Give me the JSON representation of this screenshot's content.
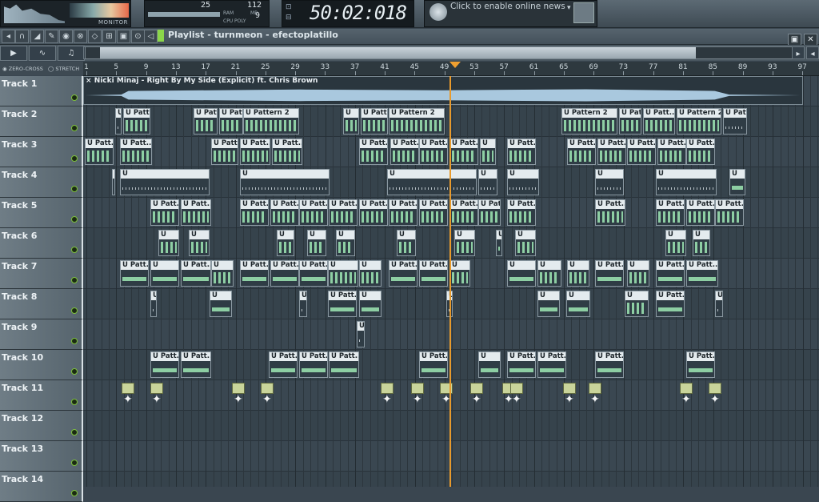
{
  "monitor": {
    "label": "MONITOR"
  },
  "cpu": {
    "value_a": "25",
    "value_b": "112",
    "value_c": "9",
    "label_ram": "RAM",
    "label_mb": "MB",
    "label_cpu": "CPU",
    "label_poly": "POLY"
  },
  "clock": {
    "time": "50:02:018",
    "icon_a": "REC",
    "icon_b": "SONG"
  },
  "news": {
    "text": "Click to enable online news"
  },
  "playlist": {
    "title": "Playlist - turnmeon - efectoplatillo"
  },
  "snap": {
    "zero_cross": "ZERO-CROSS",
    "stretch": "STRETCH"
  },
  "ruler": {
    "bars": [
      "1",
      "5",
      "9",
      "13",
      "17",
      "21",
      "25",
      "29",
      "33",
      "37",
      "41",
      "45",
      "49",
      "53",
      "57",
      "61",
      "65",
      "69",
      "73",
      "77",
      "81",
      "85",
      "89",
      "93",
      "97"
    ]
  },
  "audio_clip": {
    "name": "Nicki Minaj - Right By My Side (Explicit) ft. Chris Brown"
  },
  "tracks": [
    "Track 1",
    "Track 2",
    "Track 3",
    "Track 4",
    "Track 5",
    "Track 6",
    "Track 7",
    "Track 8",
    "Track 9",
    "Track 10",
    "Track 11",
    "Track 12",
    "Track 13",
    "Track 14"
  ],
  "clip_labels": {
    "patt": "Patt...",
    "pattern2": "Pattern 2",
    "u": "U"
  },
  "icons": [
    "pointer-icon",
    "magnet-icon",
    "paint-icon",
    "delete-icon",
    "mute-icon",
    "slip-icon",
    "slice-icon",
    "select-icon",
    "zoom-icon",
    "playback-icon",
    "maximize-icon",
    "close-icon"
  ]
}
